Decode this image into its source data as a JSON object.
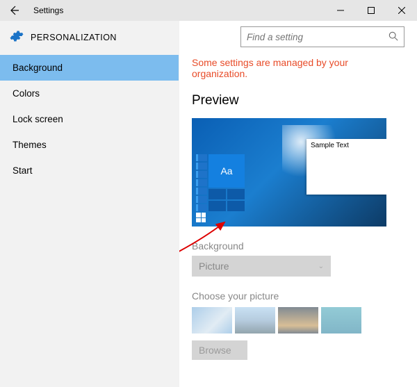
{
  "titlebar": {
    "app_title": "Settings"
  },
  "sidebar": {
    "heading": "PERSONALIZATION",
    "items": [
      {
        "label": "Background",
        "active": true
      },
      {
        "label": "Colors",
        "active": false
      },
      {
        "label": "Lock screen",
        "active": false
      },
      {
        "label": "Themes",
        "active": false
      },
      {
        "label": "Start",
        "active": false
      }
    ]
  },
  "search": {
    "placeholder": "Find a setting"
  },
  "main": {
    "org_message": "Some settings are managed by your organization.",
    "preview_heading": "Preview",
    "preview_sample_text": "Sample Text",
    "preview_tile_label": "Aa",
    "background_label": "Background",
    "background_dropdown_value": "Picture",
    "choose_picture_label": "Choose your picture",
    "browse_label": "Browse"
  }
}
